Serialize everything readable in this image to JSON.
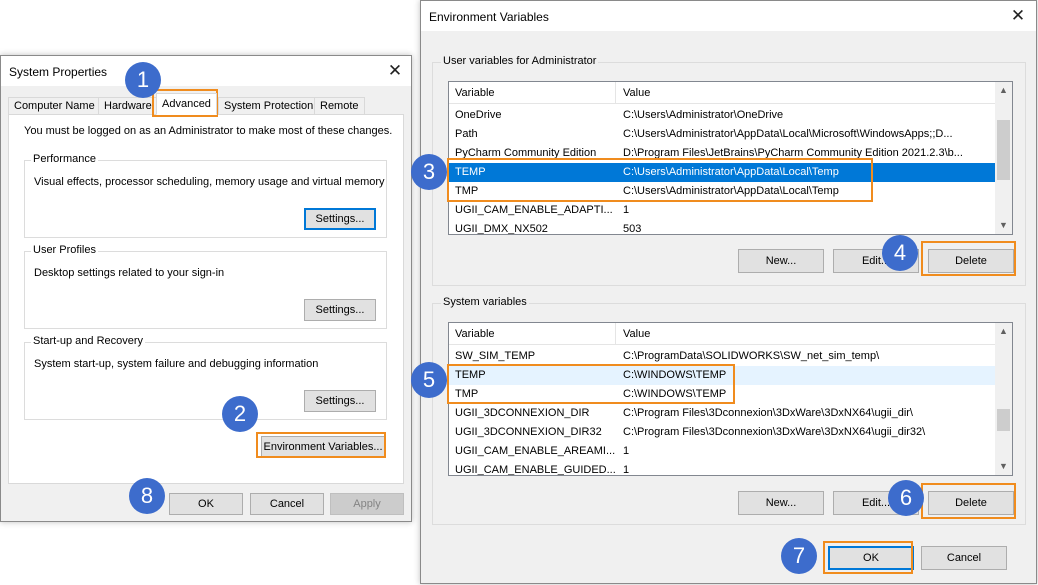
{
  "sysprops": {
    "title": "System Properties",
    "close": "✕",
    "tabs": [
      "Computer Name",
      "Hardware",
      "Advanced",
      "System Protection",
      "Remote"
    ],
    "admin_note": "You must be logged on as an Administrator to make most of these changes.",
    "performance": {
      "label": "Performance",
      "desc": "Visual effects, processor scheduling, memory usage and virtual memory",
      "button": "Settings..."
    },
    "user_profiles": {
      "label": "User Profiles",
      "desc": "Desktop settings related to your sign-in",
      "button": "Settings..."
    },
    "startup": {
      "label": "Start-up and Recovery",
      "desc": "System start-up, system failure and debugging information",
      "button": "Settings..."
    },
    "env_button": "Environment Variables...",
    "ok": "OK",
    "cancel": "Cancel",
    "apply": "Apply"
  },
  "envvars": {
    "title": "Environment Variables",
    "close": "✕",
    "user_group_label": "User variables for Administrator",
    "system_group_label": "System variables",
    "col_variable": "Variable",
    "col_value": "Value",
    "user_rows": [
      {
        "var": "OneDrive",
        "val": "C:\\Users\\Administrator\\OneDrive"
      },
      {
        "var": "Path",
        "val": "C:\\Users\\Administrator\\AppData\\Local\\Microsoft\\WindowsApps;;D..."
      },
      {
        "var": "PyCharm Community Edition",
        "val": "D:\\Program Files\\JetBrains\\PyCharm Community Edition 2021.2.3\\b..."
      },
      {
        "var": "TEMP",
        "val": "C:\\Users\\Administrator\\AppData\\Local\\Temp"
      },
      {
        "var": "TMP",
        "val": "C:\\Users\\Administrator\\AppData\\Local\\Temp"
      },
      {
        "var": "UGII_CAM_ENABLE_ADAPTI...",
        "val": "1"
      },
      {
        "var": "UGII_DMX_NX502",
        "val": "503"
      }
    ],
    "system_rows": [
      {
        "var": "SW_SIM_TEMP",
        "val": "C:\\ProgramData\\SOLIDWORKS\\SW_net_sim_temp\\"
      },
      {
        "var": "TEMP",
        "val": "C:\\WINDOWS\\TEMP"
      },
      {
        "var": "TMP",
        "val": "C:\\WINDOWS\\TEMP"
      },
      {
        "var": "UGII_3DCONNEXION_DIR",
        "val": "C:\\Program Files\\3Dconnexion\\3DxWare\\3DxNX64\\ugii_dir\\"
      },
      {
        "var": "UGII_3DCONNEXION_DIR32",
        "val": "C:\\Program Files\\3Dconnexion\\3DxWare\\3DxNX64\\ugii_dir32\\"
      },
      {
        "var": "UGII_CAM_ENABLE_AREAMI...",
        "val": "1"
      },
      {
        "var": "UGII_CAM_ENABLE_GUIDED...",
        "val": "1"
      }
    ],
    "new": "New...",
    "edit": "Edit...",
    "delete": "Delete",
    "ok": "OK",
    "cancel": "Cancel"
  },
  "steps": [
    "1",
    "2",
    "3",
    "4",
    "5",
    "6",
    "7",
    "8"
  ],
  "colors": {
    "highlight": "#f08c1e",
    "badge": "#3d6ccc",
    "selection": "#0078d7"
  }
}
